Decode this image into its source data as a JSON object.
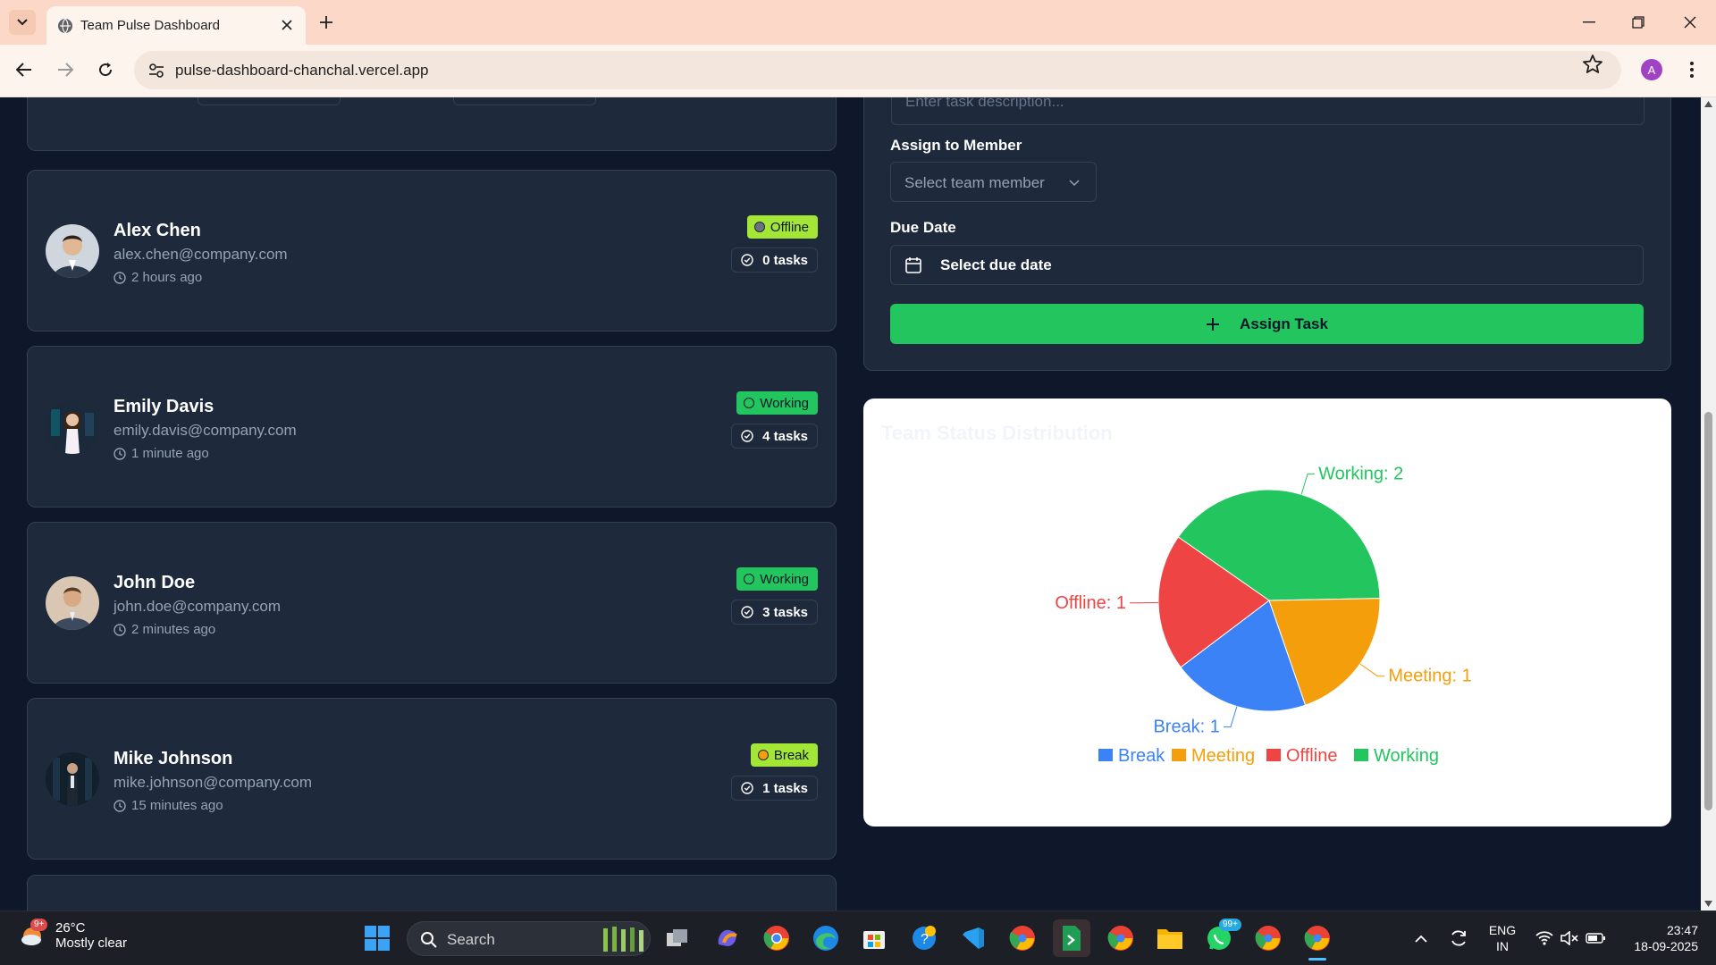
{
  "browser": {
    "tab_title": "Team Pulse Dashboard",
    "url": "pulse-dashboard-chanchal.vercel.app",
    "profile_initial": "A"
  },
  "members": [
    {
      "name": "Alex Chen",
      "email": "alex.chen@company.com",
      "last_seen": "2 hours ago",
      "status": "Offline",
      "tasks": "0 tasks",
      "status_color": "#a3e635"
    },
    {
      "name": "Emily Davis",
      "email": "emily.davis@company.com",
      "last_seen": "1 minute ago",
      "status": "Working",
      "tasks": "4 tasks",
      "status_color": "#22c55e"
    },
    {
      "name": "John Doe",
      "email": "john.doe@company.com",
      "last_seen": "2 minutes ago",
      "status": "Working",
      "tasks": "3 tasks",
      "status_color": "#22c55e"
    },
    {
      "name": "Mike Johnson",
      "email": "mike.johnson@company.com",
      "last_seen": "15 minutes ago",
      "status": "Break",
      "tasks": "1 tasks",
      "status_color": "#a3e635"
    }
  ],
  "task_form": {
    "description_placeholder": "Enter task description...",
    "assign_label": "Assign to Member",
    "member_placeholder": "Select team member",
    "due_label": "Due Date",
    "due_placeholder": "Select due date",
    "submit_label": "Assign Task"
  },
  "chart_data": {
    "type": "pie",
    "title": "Team Status Distribution",
    "categories": [
      "Working",
      "Meeting",
      "Break",
      "Offline"
    ],
    "values": [
      2,
      1,
      1,
      1
    ],
    "colors": [
      "#22c55e",
      "#f59e0b",
      "#3b82f6",
      "#ef4444"
    ],
    "slice_labels": [
      "Working: 2",
      "Meeting: 1",
      "Break: 1",
      "Offline: 1"
    ],
    "legend": [
      {
        "name": "Break",
        "color": "#3b82f6"
      },
      {
        "name": "Meeting",
        "color": "#f59e0b"
      },
      {
        "name": "Offline",
        "color": "#ef4444"
      },
      {
        "name": "Working",
        "color": "#22c55e"
      }
    ],
    "legend_position": "bottom"
  },
  "taskbar": {
    "temperature": "26°C",
    "weather": "Mostly clear",
    "weather_badge": "9+",
    "search_label": "Search",
    "whatsapp_badge": "99+",
    "lang": "ENG",
    "region": "IN",
    "time": "23:47",
    "date": "18-09-2025"
  }
}
